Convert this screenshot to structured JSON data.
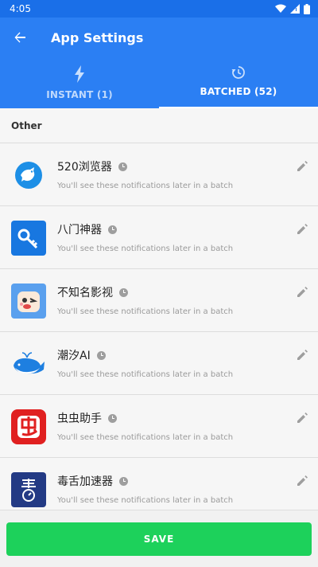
{
  "status_bar": {
    "time": "4:05"
  },
  "app_bar": {
    "title": "App Settings"
  },
  "tabs": [
    {
      "label": "INSTANT (1)",
      "icon": "lightning-icon",
      "active": false
    },
    {
      "label": "BATCHED (52)",
      "icon": "history-icon",
      "active": true
    }
  ],
  "section": {
    "title": "Other"
  },
  "apps": [
    {
      "name": "520浏览器",
      "subtitle": "You'll see these notifications later in a batch",
      "icon": "bird-app-icon"
    },
    {
      "name": "八门神器",
      "subtitle": "You'll see these notifications later in a batch",
      "icon": "key-app-icon"
    },
    {
      "name": "不知名影视",
      "subtitle": "You'll see these notifications later in a batch",
      "icon": "cartoon-app-icon"
    },
    {
      "name": "潮汐AI",
      "subtitle": "You'll see these notifications later in a batch",
      "icon": "whale-app-icon"
    },
    {
      "name": "虫虫助手",
      "subtitle": "You'll see these notifications later in a batch",
      "icon": "bug-app-icon"
    },
    {
      "name": "毒舌加速器",
      "subtitle": "You'll see these notifications later in a batch",
      "icon": "timer-app-icon"
    }
  ],
  "save": {
    "label": "SAVE"
  },
  "colors": {
    "primary": "#2b7ff3",
    "status_bar": "#1a6fe8",
    "save": "#1dd15b"
  }
}
